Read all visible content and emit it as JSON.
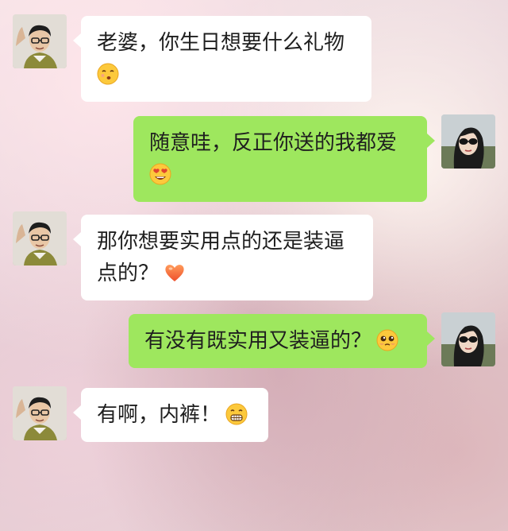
{
  "colors": {
    "incoming_bubble": "#ffffff",
    "outgoing_bubble": "#9ee75e",
    "text": "#1f1f1f"
  },
  "messages": [
    {
      "sender": "husband",
      "direction": "incoming",
      "lines": [
        "老婆，你生日想要什么礼物"
      ],
      "emoji": "kissing-face-emoji",
      "emoji_on_new_line": true
    },
    {
      "sender": "wife",
      "direction": "outgoing",
      "lines": [
        "随意哇，反正你送的我都爱"
      ],
      "emoji": "heart-eyes-face-emoji",
      "emoji_on_new_line": true
    },
    {
      "sender": "husband",
      "direction": "incoming",
      "lines": [
        "那你想要实用点的还是装逼",
        "点的？"
      ],
      "emoji": "heart-emoji",
      "emoji_on_new_line": false
    },
    {
      "sender": "wife",
      "direction": "outgoing",
      "lines": [
        "有没有既实用又装逼的？"
      ],
      "emoji": "pleading-face-emoji",
      "emoji_on_new_line": false
    },
    {
      "sender": "husband",
      "direction": "incoming",
      "lines": [
        "有啊，内裤！"
      ],
      "emoji": "grinning-face-emoji",
      "emoji_on_new_line": false
    }
  ]
}
